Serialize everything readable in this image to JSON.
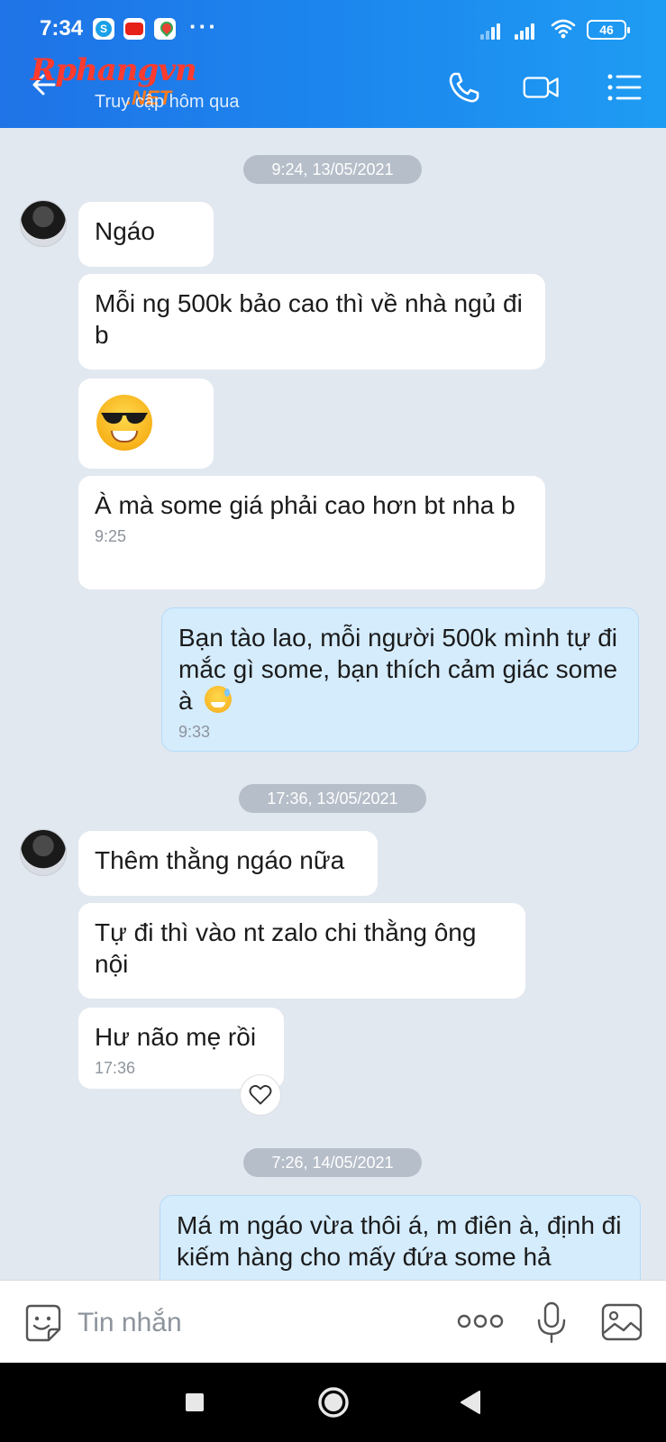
{
  "status_bar": {
    "time": "7:34",
    "notification_icons": [
      "skype-icon",
      "youtube-icon",
      "google-maps-icon"
    ],
    "more": "···",
    "battery": "46"
  },
  "header": {
    "watermark": "Rphangvn",
    "watermark_sub": ".NET",
    "subtitle": "Truy cập hôm qua",
    "accent_color": "#1c86ee"
  },
  "chat": {
    "timestamps": [
      "9:24, 13/05/2021",
      "17:36, 13/05/2021",
      "7:26, 14/05/2021"
    ],
    "group1": {
      "messages": [
        {
          "text": "Ngáo"
        },
        {
          "text": "Mỗi ng 500k bảo cao thì về nhà ngủ đi b"
        },
        {
          "emoji": "smiling-face-with-sunglasses"
        },
        {
          "text": "À mà some giá phải cao hơn bt nha b",
          "time": "9:25"
        }
      ]
    },
    "reply1": {
      "text": "Bạn tào lao, mỗi người 500k mình tự đi mắc gì some, bạn thích cảm giác some à",
      "time": "9:33",
      "emoji": "grinning-sweat"
    },
    "group2": {
      "messages": [
        {
          "text": "Thêm thằng ngáo nữa"
        },
        {
          "text": "Tự đi thì vào nt zalo chi thằng ông nội"
        },
        {
          "text": "Hư não mẹ rồi",
          "time": "17:36"
        }
      ]
    },
    "reply2": {
      "text": "Má m ngáo vừa thôi á, m điên à, định đi kiếm hàng cho mấy đứa some hả"
    }
  },
  "input_bar": {
    "placeholder": "Tin nhắn"
  }
}
